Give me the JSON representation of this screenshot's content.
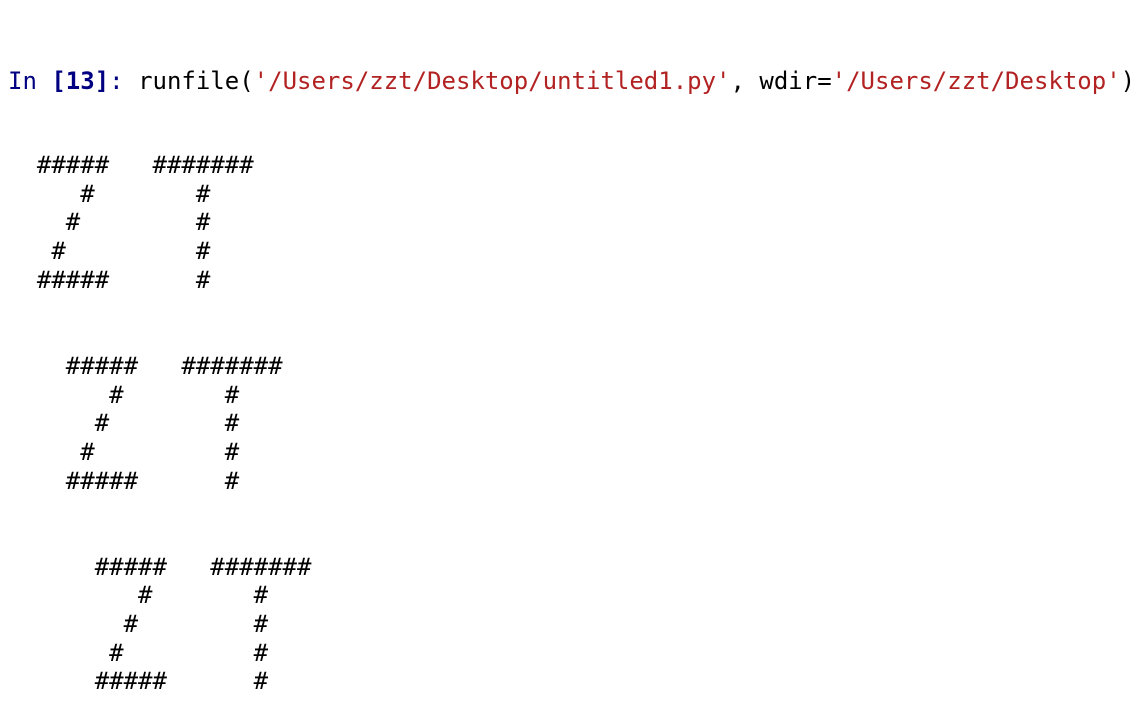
{
  "prompt": {
    "label": "In ",
    "number": "[13]",
    "suffix": ": "
  },
  "command": {
    "function": "runfile",
    "open_paren": "(",
    "path_arg": "'/Users/zzt/Desktop/untitled1.py'",
    "separator": ", ",
    "kwarg_name": "wdir",
    "equals": "=",
    "wdir_arg": "'/Users/zzt/Desktop'",
    "close_paren": ")"
  },
  "output_lines": [
    "  #####   #######",
    "     #       #",
    "    #        #",
    "   #         #",
    "  #####      #",
    "",
    "",
    "    #####   #######",
    "       #       #",
    "      #        #",
    "     #         #",
    "    #####      #",
    "",
    "",
    "      #####   #######",
    "         #       #",
    "        #        #",
    "       #         #",
    "      #####      #"
  ],
  "colors": {
    "prompt": "#000080",
    "string": "#b22222",
    "text": "#000000",
    "background": "#ffffff"
  }
}
